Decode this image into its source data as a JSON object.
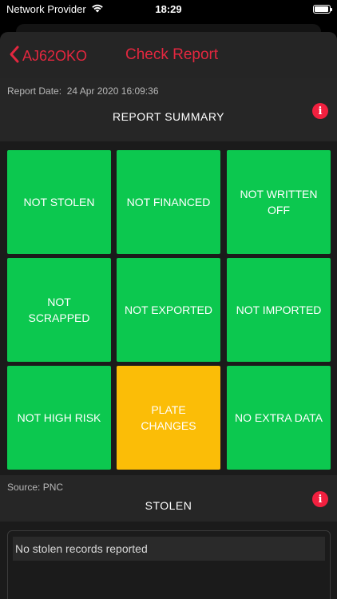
{
  "status_bar": {
    "carrier": "Network Provider",
    "time": "18:29",
    "wifi_icon": "wifi-icon",
    "battery_icon": "battery-icon",
    "battery_level": 0.95
  },
  "nav": {
    "back_label": "AJ62OKO",
    "title": "Check Report",
    "accent_color": "#e3273f"
  },
  "summary": {
    "report_date_label": "Report Date:",
    "report_date": "24 Apr 2020 16:09:36",
    "title": "REPORT SUMMARY",
    "info_icon": "i",
    "tiles": [
      {
        "label": "NOT STOLEN",
        "status": "ok"
      },
      {
        "label": "NOT FINANCED",
        "status": "ok"
      },
      {
        "label": "NOT WRITTEN OFF",
        "status": "ok"
      },
      {
        "label": "NOT SCRAPPED",
        "status": "ok"
      },
      {
        "label": "NOT EXPORTED",
        "status": "ok"
      },
      {
        "label": "NOT IMPORTED",
        "status": "ok"
      },
      {
        "label": "NOT HIGH RISK",
        "status": "ok"
      },
      {
        "label": "PLATE CHANGES",
        "status": "warning"
      },
      {
        "label": "NO EXTRA DATA",
        "status": "ok"
      }
    ],
    "colors": {
      "ok": "#0cc84f",
      "warning": "#fbbd07"
    }
  },
  "stolen": {
    "source_label": "Source: PNC",
    "title": "STOLEN",
    "info_icon": "i",
    "records_message": "No stolen records reported"
  }
}
